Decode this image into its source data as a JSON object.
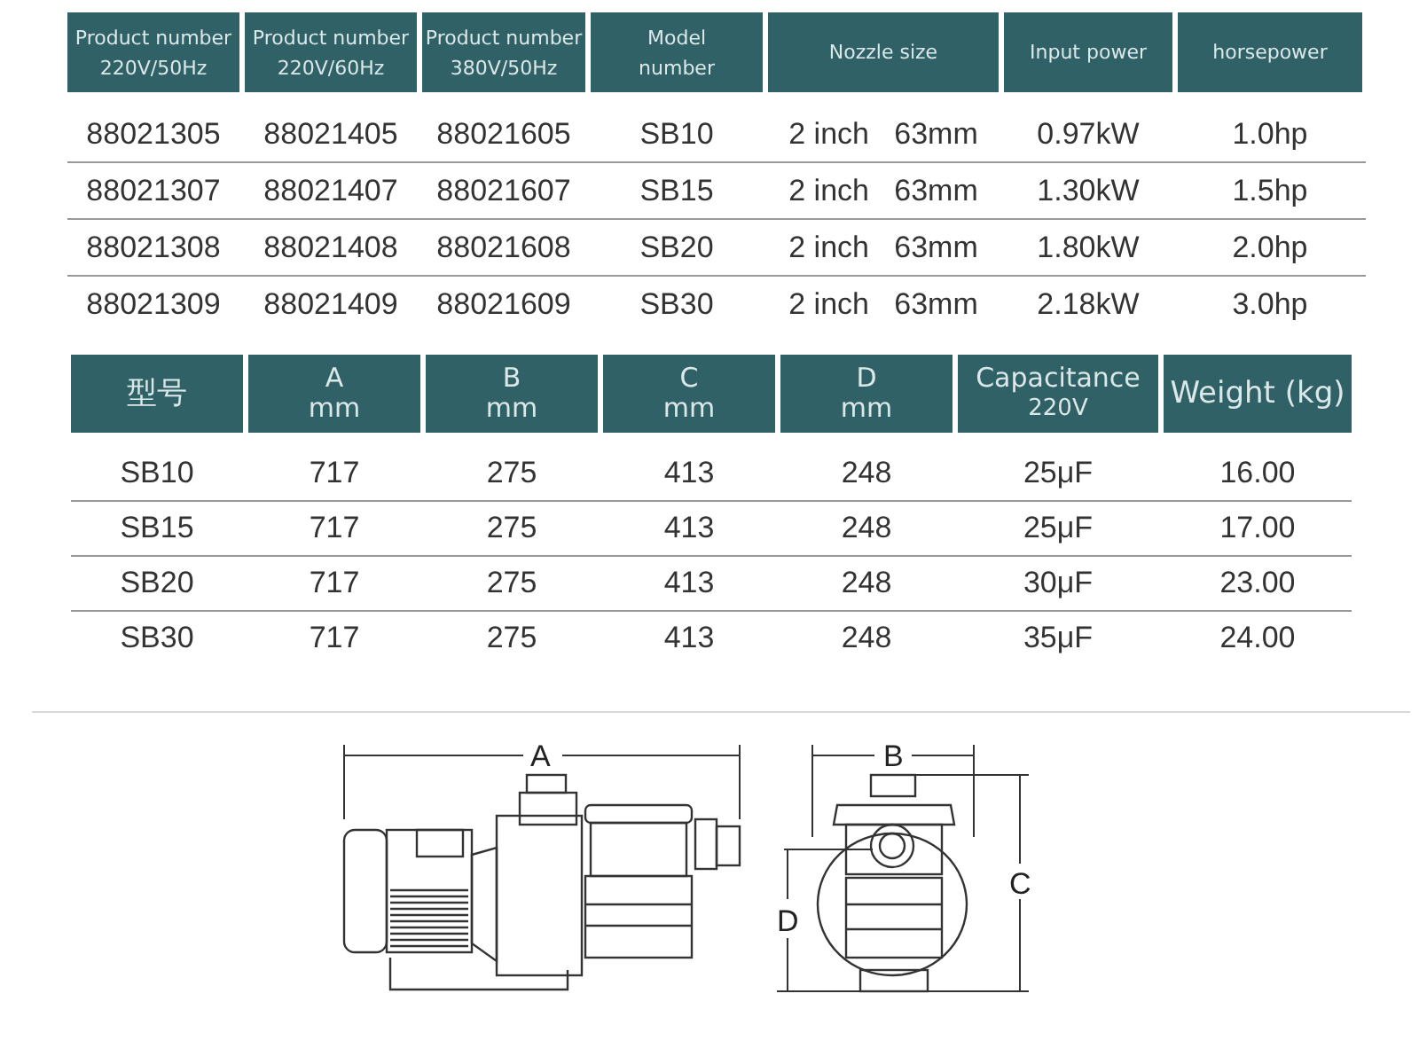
{
  "specs_table": {
    "columns": [
      {
        "lines": [
          "Product number",
          "220V/50Hz"
        ]
      },
      {
        "lines": [
          "Product number",
          "220V/60Hz"
        ]
      },
      {
        "lines": [
          "Product number",
          "380V/50Hz"
        ]
      },
      {
        "lines": [
          "Model",
          "number"
        ]
      },
      {
        "lines": [
          "Nozzle size"
        ]
      },
      {
        "lines": [
          "Input power"
        ]
      },
      {
        "lines": [
          "horsepower"
        ]
      }
    ],
    "rows": [
      [
        "88021305",
        "88021405",
        "88021605",
        "SB10",
        "2 inch   63mm",
        "0.97kW",
        "1.0hp"
      ],
      [
        "88021307",
        "88021407",
        "88021607",
        "SB15",
        "2 inch   63mm",
        "1.30kW",
        "1.5hp"
      ],
      [
        "88021308",
        "88021408",
        "88021608",
        "SB20",
        "2 inch   63mm",
        "1.80kW",
        "2.0hp"
      ],
      [
        "88021309",
        "88021409",
        "88021609",
        "SB30",
        "2 inch   63mm",
        "2.18kW",
        "3.0hp"
      ]
    ]
  },
  "dimensions_table": {
    "columns": [
      {
        "lines": [
          "型号"
        ]
      },
      {
        "lines": [
          "A",
          "mm"
        ]
      },
      {
        "lines": [
          "B",
          "mm"
        ]
      },
      {
        "lines": [
          "C",
          "mm"
        ]
      },
      {
        "lines": [
          "D",
          "mm"
        ]
      },
      {
        "lines": [
          "Capacitance",
          "220V"
        ]
      },
      {
        "lines": [
          "Weight (kg)"
        ]
      }
    ],
    "rows": [
      [
        "SB10",
        "717",
        "275",
        "413",
        "248",
        "25μF",
        "16.00"
      ],
      [
        "SB15",
        "717",
        "275",
        "413",
        "248",
        "25μF",
        "17.00"
      ],
      [
        "SB20",
        "717",
        "275",
        "413",
        "248",
        "30μF",
        "23.00"
      ],
      [
        "SB30",
        "717",
        "275",
        "413",
        "248",
        "35μF",
        "24.00"
      ]
    ]
  },
  "diagram": {
    "labels": [
      "A",
      "B",
      "C",
      "D"
    ]
  }
}
